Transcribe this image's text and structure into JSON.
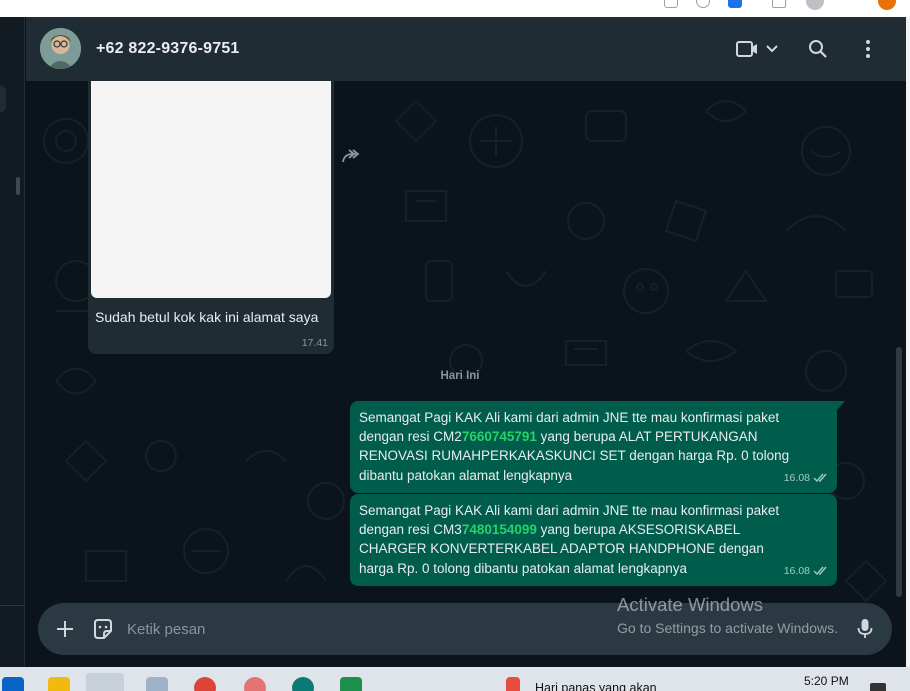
{
  "header": {
    "contact_name": "+62 822-9376-9751"
  },
  "messages": {
    "incoming": {
      "text": "Sudah betul kok kak ini alamat saya",
      "time": "17.41"
    },
    "day_divider": "Hari Ini",
    "outgoing": [
      {
        "text_before": "Semangat Pagi KAK Ali kami dari admin JNE tte mau konfirmasi paket dengan resi CM2",
        "highlight": "7660745791",
        "text_after": " yang berupa ALAT PERTUKANGAN RENOVASI RUMAHPERKAKASKUNCI SET dengan harga Rp. 0 tolong dibantu patokan alamat lengkapnya",
        "time": "16.08"
      },
      {
        "text_before": "Semangat Pagi KAK Ali kami dari admin JNE tte mau konfirmasi paket dengan resi CM3",
        "highlight": "7480154099",
        "text_after": " yang berupa AKSESORISKABEL CHARGER KONVERTERKABEL ADAPTOR HANDPHONE dengan harga Rp. 0 tolong dibantu patokan alamat lengkapnya",
        "time": "16.08"
      }
    ]
  },
  "composer": {
    "placeholder": "Ketik pesan"
  },
  "watermark": {
    "title": "Activate Windows",
    "subtitle": "Go to Settings to activate Windows."
  },
  "taskbar": {
    "weather_text": "Hari panas yang akan",
    "clock": "5:20 PM"
  },
  "colors": {
    "header_bg": "#202c33",
    "chat_bg": "#0b141a",
    "incoming_bubble": "#202c33",
    "outgoing_bubble": "#005c4b",
    "link_green": "#25d366",
    "text_primary": "#e9edef",
    "text_secondary": "#8696a0"
  },
  "icons": {
    "video_call": "video-camera-icon",
    "search": "search-icon",
    "menu": "kebab-menu-icon",
    "attach": "plus-icon",
    "sticker": "sticker-icon",
    "mic": "microphone-icon",
    "read_receipt": "double-check-icon",
    "forward": "forward-icon"
  }
}
